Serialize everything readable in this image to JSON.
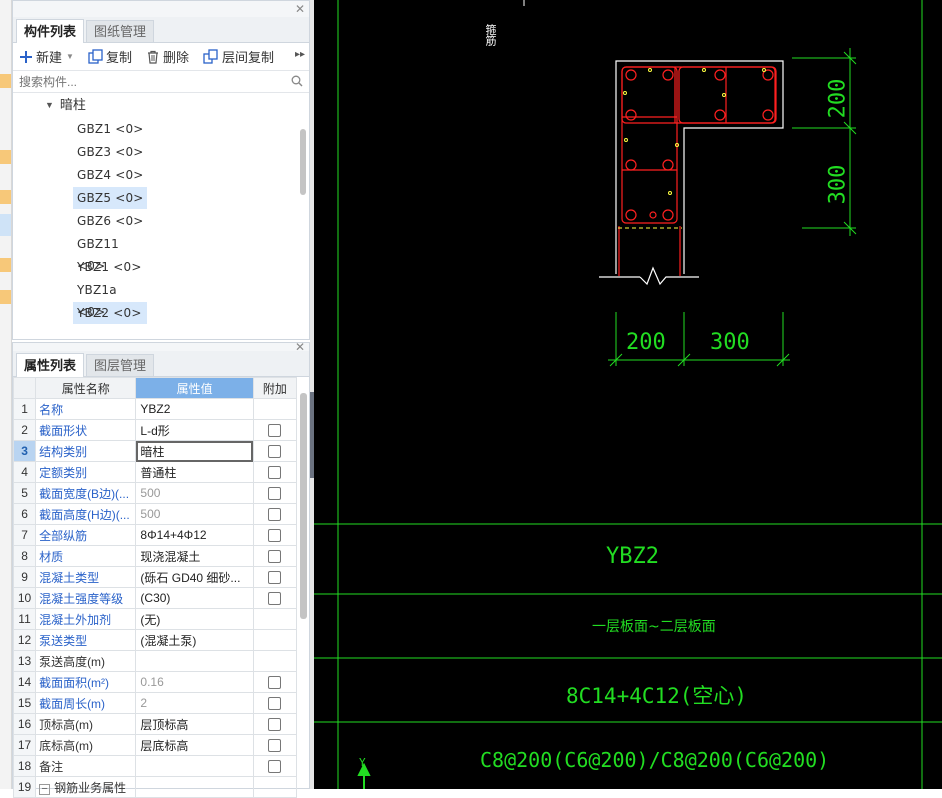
{
  "component_panel": {
    "tabs": [
      "构件列表",
      "图纸管理"
    ],
    "toolbar": {
      "new": "新建",
      "copy": "复制",
      "delete": "删除",
      "floor_copy": "层间复制"
    },
    "search_placeholder": "搜索构件...",
    "tree": {
      "group": "暗柱",
      "items": [
        "GBZ1 <0>",
        "GBZ3 <0>",
        "GBZ4 <0>",
        "GBZ5 <0>",
        "GBZ6 <0>",
        "GBZ11 <0>",
        "YBZ1 <0>",
        "YBZ1a <0>",
        "YBZ2 <0>"
      ]
    }
  },
  "property_panel": {
    "tabs": [
      "属性列表",
      "图层管理"
    ],
    "headers": {
      "name": "属性名称",
      "value": "属性值",
      "extra": "附加"
    },
    "rows": [
      {
        "num": "1",
        "name": "名称",
        "value": "YBZ2",
        "link": true,
        "grey": false,
        "checkbox": false
      },
      {
        "num": "2",
        "name": "截面形状",
        "value": "L-d形",
        "link": true,
        "grey": false,
        "checkbox": true
      },
      {
        "num": "3",
        "name": "结构类别",
        "value": "暗柱",
        "link": true,
        "grey": false,
        "checkbox": true
      },
      {
        "num": "4",
        "name": "定额类别",
        "value": "普通柱",
        "link": true,
        "grey": false,
        "checkbox": true
      },
      {
        "num": "5",
        "name": "截面宽度(B边)(...",
        "value": "500",
        "link": true,
        "grey": true,
        "checkbox": true
      },
      {
        "num": "6",
        "name": "截面高度(H边)(...",
        "value": "500",
        "link": true,
        "grey": true,
        "checkbox": true
      },
      {
        "num": "7",
        "name": "全部纵筋",
        "value": "8Φ14+4Φ12",
        "link": true,
        "grey": false,
        "checkbox": true
      },
      {
        "num": "8",
        "name": "材质",
        "value": "现浇混凝土",
        "link": true,
        "grey": false,
        "checkbox": true
      },
      {
        "num": "9",
        "name": "混凝土类型",
        "value": "(砾石 GD40 细砂...",
        "link": true,
        "grey": false,
        "checkbox": true
      },
      {
        "num": "10",
        "name": "混凝土强度等级",
        "value": "(C30)",
        "link": true,
        "grey": false,
        "checkbox": true
      },
      {
        "num": "11",
        "name": "混凝土外加剂",
        "value": "(无)",
        "link": true,
        "grey": false,
        "checkbox": false
      },
      {
        "num": "12",
        "name": "泵送类型",
        "value": "(混凝土泵)",
        "link": true,
        "grey": false,
        "checkbox": false
      },
      {
        "num": "13",
        "name": "泵送高度(m)",
        "value": "",
        "link": false,
        "grey": false,
        "checkbox": false
      },
      {
        "num": "14",
        "name": "截面面积(m²)",
        "value": "0.16",
        "link": true,
        "grey": true,
        "checkbox": true
      },
      {
        "num": "15",
        "name": "截面周长(m)",
        "value": "2",
        "link": true,
        "grey": true,
        "checkbox": true
      },
      {
        "num": "16",
        "name": "顶标高(m)",
        "value": "层顶标高",
        "link": false,
        "grey": false,
        "checkbox": true
      },
      {
        "num": "17",
        "name": "底标高(m)",
        "value": "层底标高",
        "link": false,
        "grey": false,
        "checkbox": true
      },
      {
        "num": "18",
        "name": "备注",
        "value": "",
        "link": false,
        "grey": false,
        "checkbox": true
      },
      {
        "num": "19",
        "name": "钢筋业务属性",
        "value": "",
        "link": false,
        "grey": false,
        "checkbox": false
      }
    ]
  },
  "cad": {
    "top_note": "箍筋",
    "dims": {
      "right_top": "200",
      "right_bottom": "300",
      "bottom_left": "200",
      "bottom_right": "300"
    },
    "table": {
      "name": "YBZ2",
      "elevation": "一层板面~二层板面",
      "longitudinal": "8C14+4C12(空心)",
      "stirrup": "C8@200(C6@200)/C8@200(C6@200)"
    },
    "axis_y": "Y",
    "colors": {
      "dim": "#22dd22",
      "rebar": "#ff2020",
      "outline": "#ffffff",
      "hatch": "#ffff40"
    }
  }
}
